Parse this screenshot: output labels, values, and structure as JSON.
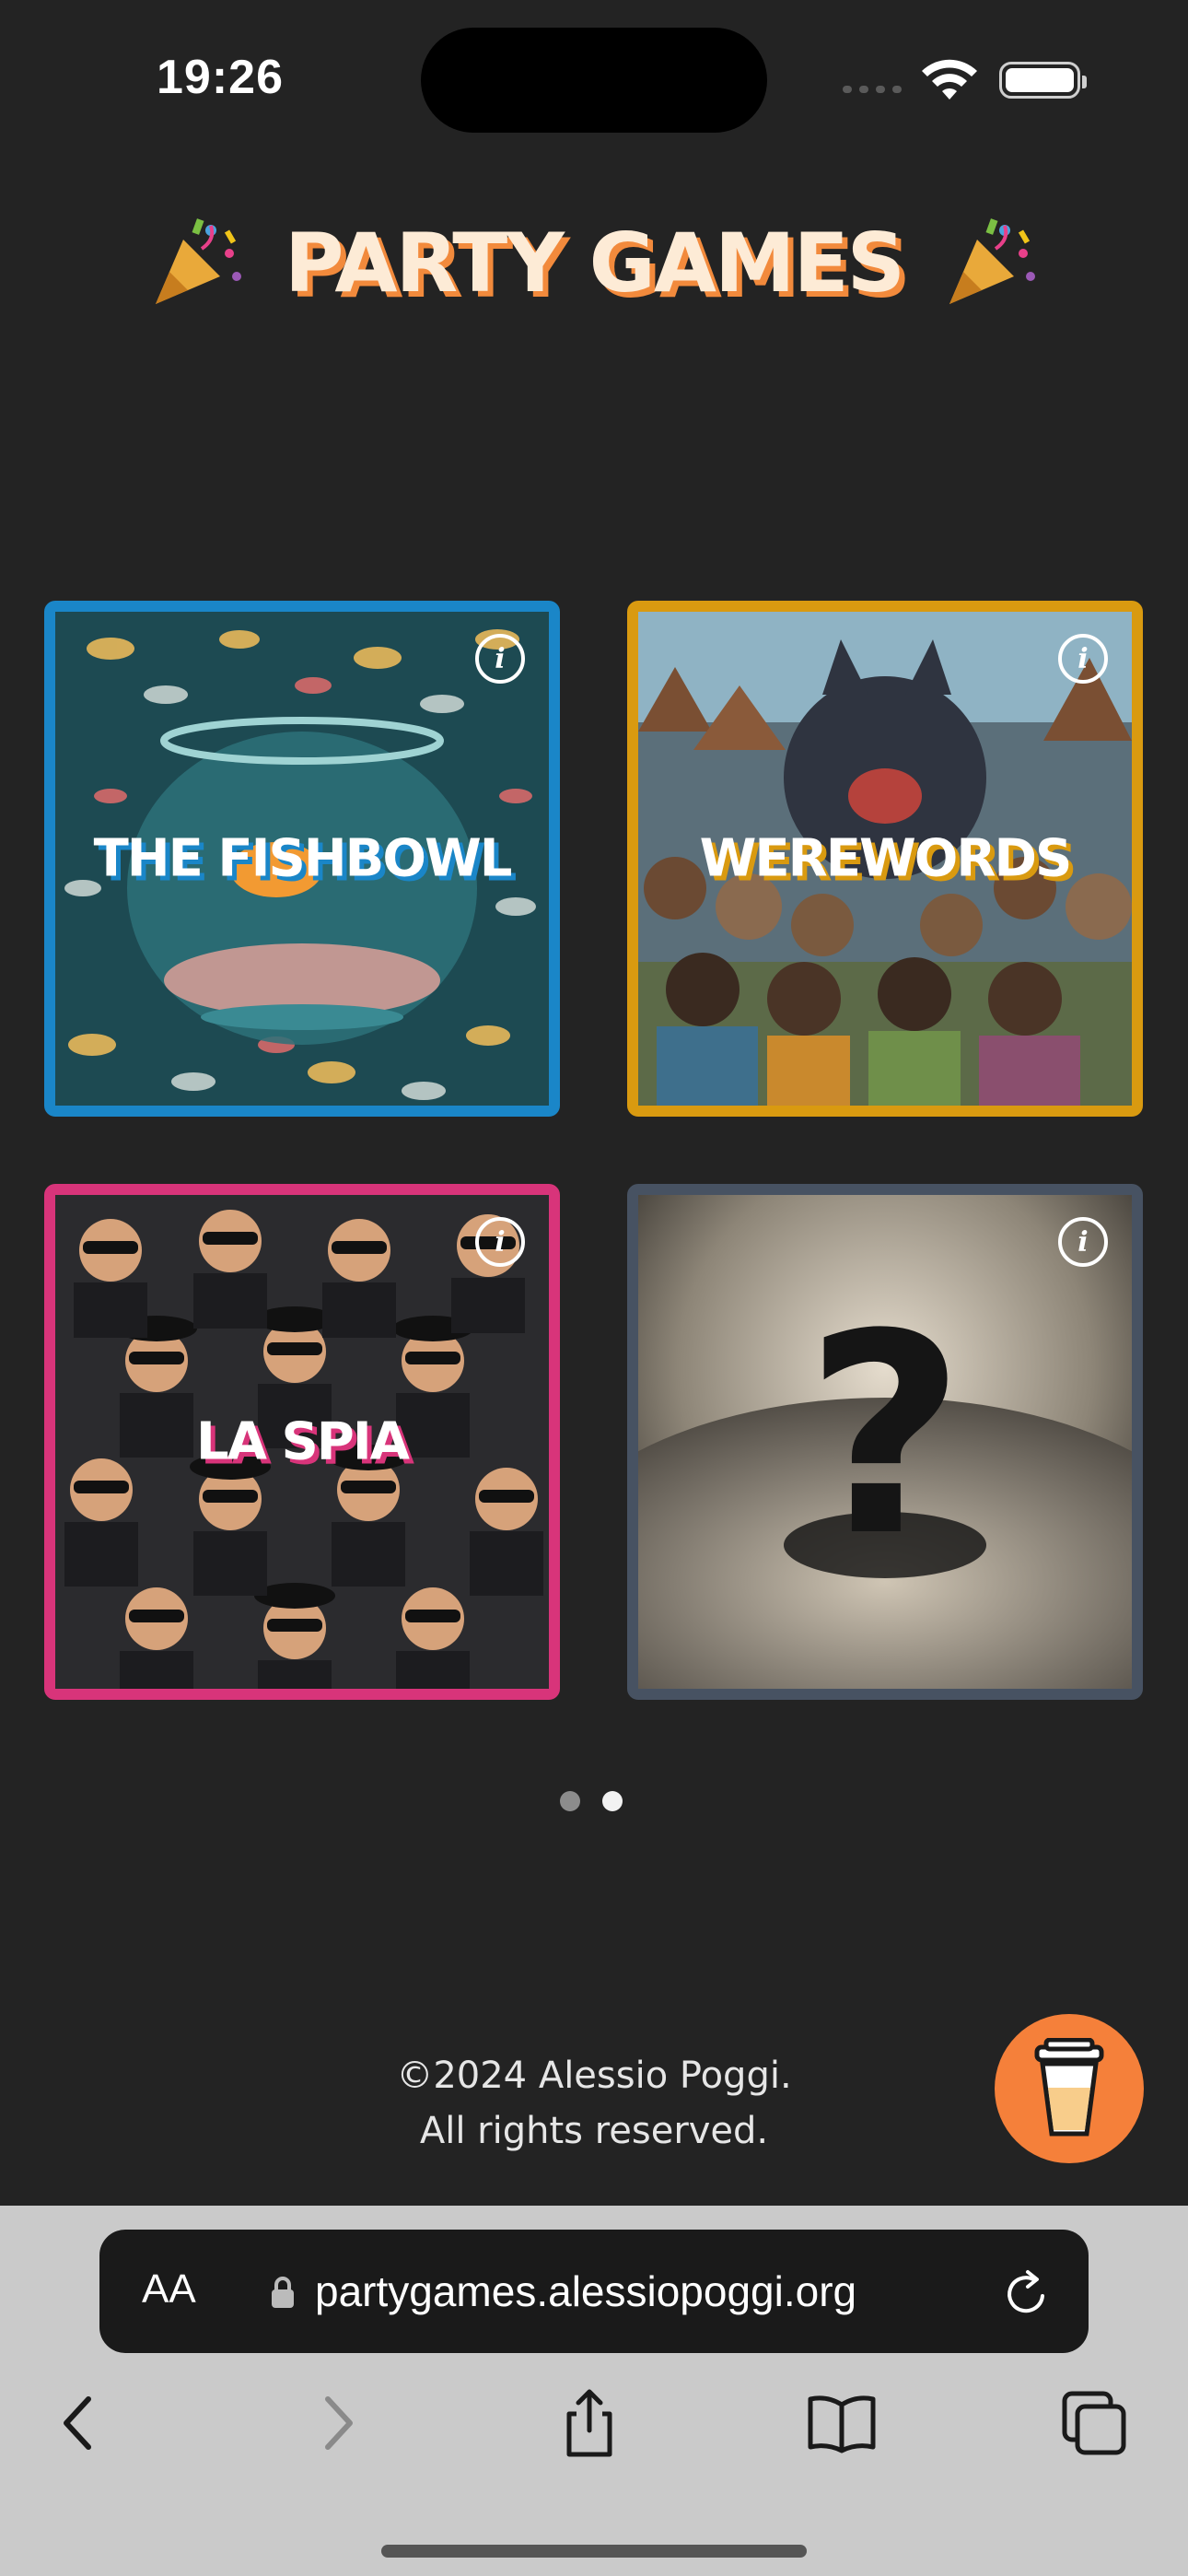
{
  "status": {
    "time": "19:26"
  },
  "header": {
    "title": "PARTY GAMES",
    "left_icon": "party-popper-icon",
    "right_icon": "party-popper-icon"
  },
  "games": [
    {
      "title": "THE FISHBOWL",
      "accent": "#1a86c8",
      "image": "fishbowl-illustration"
    },
    {
      "title": "WEREWORDS",
      "accent": "#d99a10",
      "image": "werewolf-crowd-illustration"
    },
    {
      "title": "LA SPIA",
      "accent": "#d8347a",
      "image": "spies-crowd-illustration"
    },
    {
      "title": "",
      "accent": "#475262",
      "image": "question-mark-illustration"
    }
  ],
  "info_label": "i",
  "pagination": {
    "count": 2,
    "active": 2
  },
  "footer": {
    "line1": "©2024 Alessio Poggi.",
    "line2": "All rights reserved."
  },
  "coffee_button": {
    "icon": "coffee-cup-icon",
    "color": "#f5803a"
  },
  "browser": {
    "text_size_label": "AA",
    "url": "partygames.alessiopoggi.org"
  }
}
